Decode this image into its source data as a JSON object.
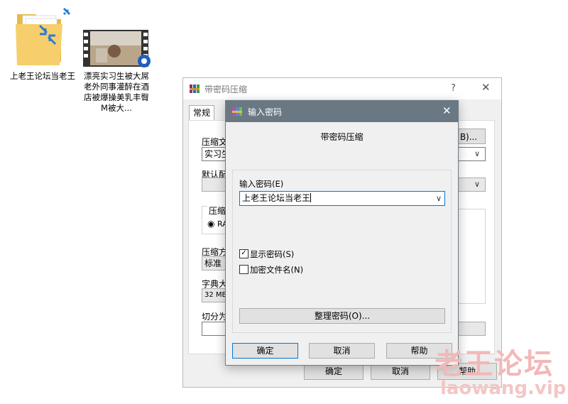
{
  "desktop": {
    "folder_label": "上老王论坛当老王",
    "video_label": "漂亮实习生被大屌老外同事灌醉在酒店被爆操美乳丰臀M被大..."
  },
  "back_dialog": {
    "title": "带密码压缩",
    "help_btn": "?",
    "close_btn": "✕",
    "tab_general": "常规",
    "archive_name_label": "压缩文",
    "archive_name_value": "实习生",
    "browse_btn": "B)...",
    "default_profile_label": "默认配",
    "format_group_label": "压缩",
    "format_radio_label": "RA",
    "method_label": "压缩方",
    "method_value": "标准",
    "dict_label": "字典大",
    "dict_value": "32 MB",
    "split_label": "切分为",
    "ok_btn": "确定",
    "cancel_btn": "取消",
    "help_btn_bottom": "帮助"
  },
  "front_dialog": {
    "title": "输入密码",
    "close_btn": "✕",
    "heading": "带密码压缩",
    "password_label": "输入密码(E)",
    "password_value": "上老王论坛当老王",
    "show_password_label": "显示密码(S)",
    "show_password_checked": true,
    "encrypt_filenames_label": "加密文件名(N)",
    "encrypt_filenames_checked": false,
    "organize_btn": "整理密码(O)...",
    "ok_btn": "确定",
    "cancel_btn": "取消",
    "help_btn": "帮助"
  },
  "watermark": {
    "cn": "老王论坛",
    "en": "laowang.vip"
  },
  "colors": {
    "front_title_bar": "#6a7884",
    "button_face": "#e1e1e1",
    "focus_border": "#0078d7"
  }
}
